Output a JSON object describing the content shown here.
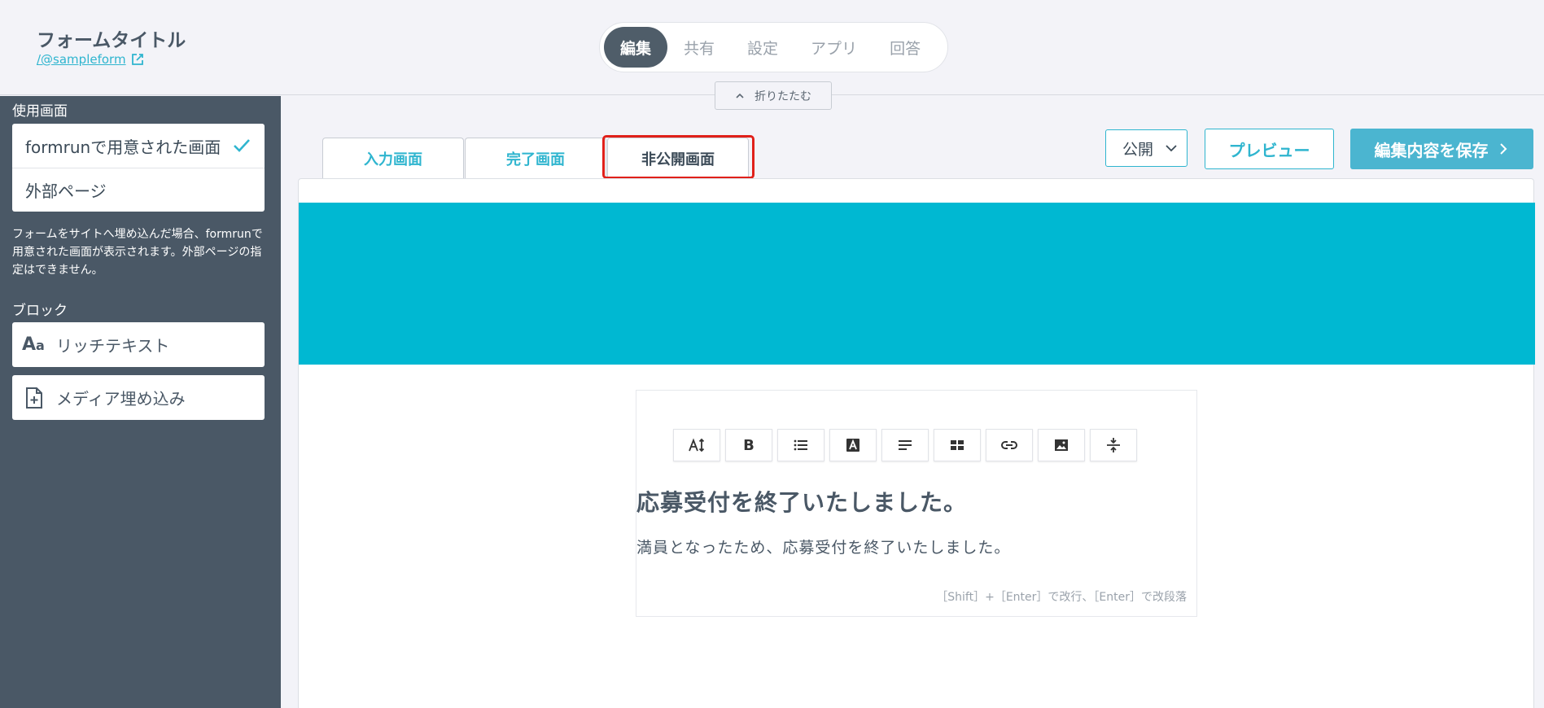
{
  "header": {
    "title": "フォームタイトル",
    "link": "/@sampleform",
    "tabs": [
      "編集",
      "共有",
      "設定",
      "アプリ",
      "回答"
    ],
    "active_tab": "編集",
    "collapse_label": "折りたたむ"
  },
  "sidebar": {
    "screen_heading": "使用画面",
    "screen_options": [
      {
        "label": "formrunで用意された画面",
        "selected": true
      },
      {
        "label": "外部ページ",
        "selected": false
      }
    ],
    "note": "フォームをサイトへ埋め込んだ場合、formrunで用意された画面が表示されます。外部ページの指定はできません。",
    "block_heading": "ブロック",
    "blocks": [
      {
        "label": "リッチテキスト",
        "icon": "aa-icon"
      },
      {
        "label": "メディア埋め込み",
        "icon": "file-plus-icon"
      }
    ]
  },
  "screen_tabs": [
    {
      "label": "入力画面",
      "active": false
    },
    {
      "label": "完了画面",
      "active": false
    },
    {
      "label": "非公開画面",
      "active": true
    }
  ],
  "actions": {
    "status_value": "公開",
    "preview_label": "プレビュー",
    "save_label": "編集内容を保存"
  },
  "colors": {
    "accent": "#2fb5cf",
    "banner": "#00b8d2",
    "sidebar": "#4a5866",
    "highlight": "#e0201a"
  },
  "editor": {
    "toolbar": [
      "text-size-icon",
      "bold-icon",
      "list-icon",
      "text-color-icon",
      "align-icon",
      "table-icon",
      "link-icon",
      "image-icon",
      "divider-icon"
    ],
    "bold_glyph": "B",
    "heading": "応募受付を終了いたしました。",
    "body": "満員となったため、応募受付を終了いたしました。",
    "hint": "［Shift］+［Enter］で改行、［Enter］で改段落"
  }
}
